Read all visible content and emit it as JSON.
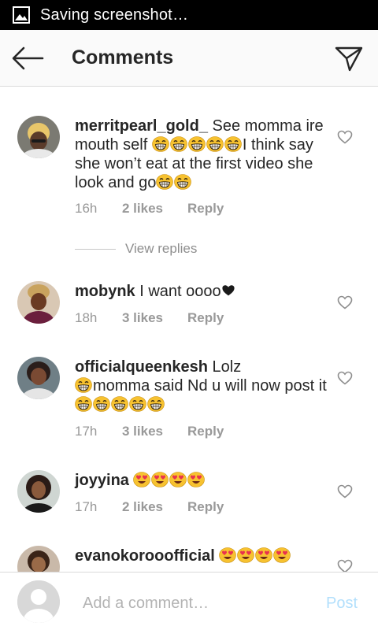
{
  "status_bar": {
    "text": "Saving screenshot…",
    "icon": "image-icon"
  },
  "app_bar": {
    "title": "Comments",
    "back_icon": "arrow-left-icon",
    "send_icon": "direct-send-icon"
  },
  "comments": [
    {
      "username": "merritpearl_gold_",
      "text_parts": [
        "See momma ire mouth self ",
        "I think say she won’t eat at the first video she look and go"
      ],
      "time": "16h",
      "likes": "2 likes",
      "reply": "Reply"
    },
    {
      "username": "mobynk",
      "text_parts": [
        "I want oooo"
      ],
      "time": "18h",
      "likes": "3 likes",
      "reply": "Reply"
    },
    {
      "username": "officialqueenkesh",
      "text_parts": [
        "Lolz",
        "momma said Nd u will now post it "
      ],
      "time": "17h",
      "likes": "3 likes",
      "reply": "Reply"
    },
    {
      "username": "joyyina",
      "text_parts": [],
      "time": "17h",
      "likes": "2 likes",
      "reply": "Reply"
    },
    {
      "username": "evanokorooofficial",
      "text_parts": []
    }
  ],
  "view_replies": "View replies",
  "composer": {
    "placeholder": "Add a comment…",
    "post_label": "Post"
  },
  "colors": {
    "text": "#262626",
    "meta": "#999999",
    "post_disabled": "#b2dffc",
    "emoji_grin": "#f7c230",
    "emoji_heart_eyes": "#e8314f"
  }
}
